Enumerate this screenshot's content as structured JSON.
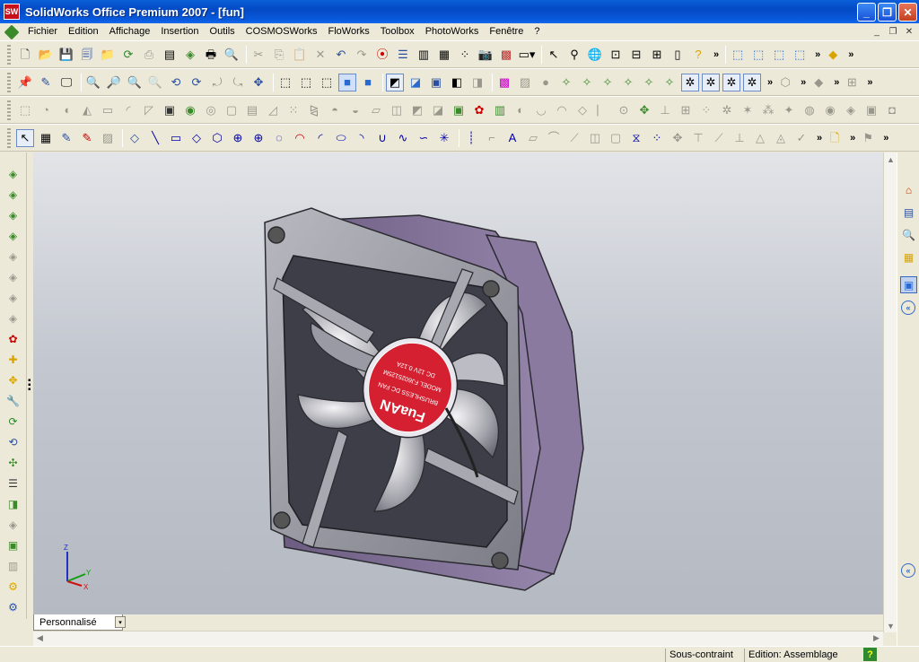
{
  "window": {
    "logo_text": "SW",
    "title": "SolidWorks Office Premium 2007 - [fun]",
    "minimize": "_",
    "restore": "❐",
    "close": "✕"
  },
  "menu": {
    "items": [
      "Fichier",
      "Edition",
      "Affichage",
      "Insertion",
      "Outils",
      "COSMOSWorks",
      "FloWorks",
      "Toolbox",
      "PhotoWorks",
      "Fenêtre",
      "?"
    ],
    "mdi_minimize": "_",
    "mdi_restore": "❐",
    "mdi_close": "✕"
  },
  "viewport": {
    "label_text": {
      "brand": "FuaAN",
      "line1": "BRUSHLESS DC FAN",
      "line2": "MODEL FJ6025125M",
      "line3": "DC 12V 0.12A"
    },
    "triad": {
      "x": "X",
      "y": "Y",
      "z": "Z"
    }
  },
  "sheet_tab": {
    "label": "Personnalisé",
    "dropdown": "▾"
  },
  "status": {
    "constraint": "Sous-contraint",
    "mode": "Edition: Assemblage",
    "help": "?"
  }
}
